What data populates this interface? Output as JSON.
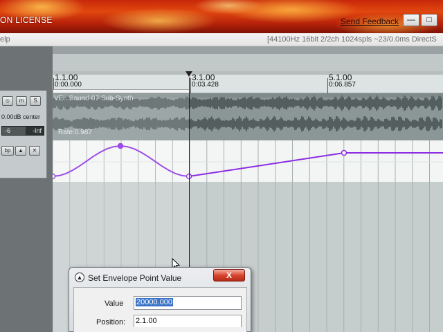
{
  "titlebar": {
    "title_fragment": "ON LICENSE",
    "send_feedback": "Send Feedback",
    "minimize_glyph": "—",
    "maximize_glyph": "□"
  },
  "menubar": {
    "help_fragment": "elp",
    "status": "[44100Hz 16bit 2/2ch 1024spls ~23/0.0ms DirectS"
  },
  "track": {
    "buttons": {
      "fx": "⦸",
      "mute": "m",
      "solo": "S"
    },
    "volume_pan": "0.00dB center",
    "fader_min": "-6",
    "fader_max": "-Inf",
    "envelope_buttons": {
      "bypass": "bp",
      "hide": "▲",
      "close": "✕"
    }
  },
  "ruler": {
    "markers": [
      {
        "measure": "1.1.00",
        "time": "0:00.000"
      },
      {
        "measure": "3.1.00",
        "time": "0:03.428"
      },
      {
        "measure": "5.1.00",
        "time": "0:06.857"
      }
    ]
  },
  "item": {
    "name": "VE...Sound-07 Sub-Synth",
    "rate": "Rate:0.987"
  },
  "envelope": {
    "color": "#8a2be2",
    "points": [
      {
        "position": "1.1.00",
        "selected": false
      },
      {
        "position": "1.3.00",
        "selected": false
      },
      {
        "position": "2.1.00",
        "selected": true
      },
      {
        "position": "5.1.00",
        "selected": false
      }
    ]
  },
  "dialog": {
    "title": "Set Envelope Point Value",
    "close_glyph": "X",
    "value_label": "Value",
    "value": "20000.000",
    "position_label": "Position:",
    "position": "2.1.00"
  }
}
